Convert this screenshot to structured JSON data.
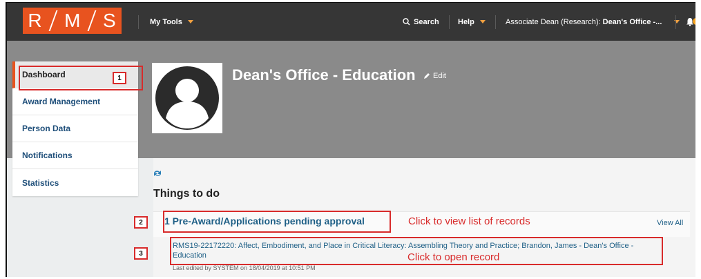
{
  "logo": {
    "letters": [
      "R",
      "M",
      "S"
    ]
  },
  "nav": {
    "my_tools": "My Tools",
    "search": "Search",
    "help": "Help",
    "role_label": "Associate Dean (Research):",
    "role_value": "Dean's Office -...",
    "notification_count": "1"
  },
  "sidebar": {
    "items": [
      {
        "label": "Dashboard"
      },
      {
        "label": "Award Management"
      },
      {
        "label": "Person Data"
      },
      {
        "label": "Notifications"
      },
      {
        "label": "Statistics"
      }
    ]
  },
  "header": {
    "title": "Dean's Office - Education",
    "edit_label": "Edit"
  },
  "main": {
    "section_title": "Things to do",
    "pending_label": "1 Pre-Award/Applications pending approval",
    "view_all": "View All",
    "record_title": "RMS19-22172220: Affect, Embodiment, and Place in Critical Literacy: Assembling Theory and Practice; Brandon, James - Dean's Office - Education",
    "record_meta": "Last edited by SYSTEM on 18/04/2019 at 10:51 PM"
  },
  "annotations": {
    "step1": "1",
    "step2": "2",
    "step3": "3",
    "note2": "Click to view list of records",
    "note3": "Click to open record"
  },
  "colors": {
    "brand": "#e8531f",
    "topbar": "#363636",
    "banner": "#8a8a8a",
    "link": "#1e5f86",
    "annotation": "#d82b2b"
  }
}
